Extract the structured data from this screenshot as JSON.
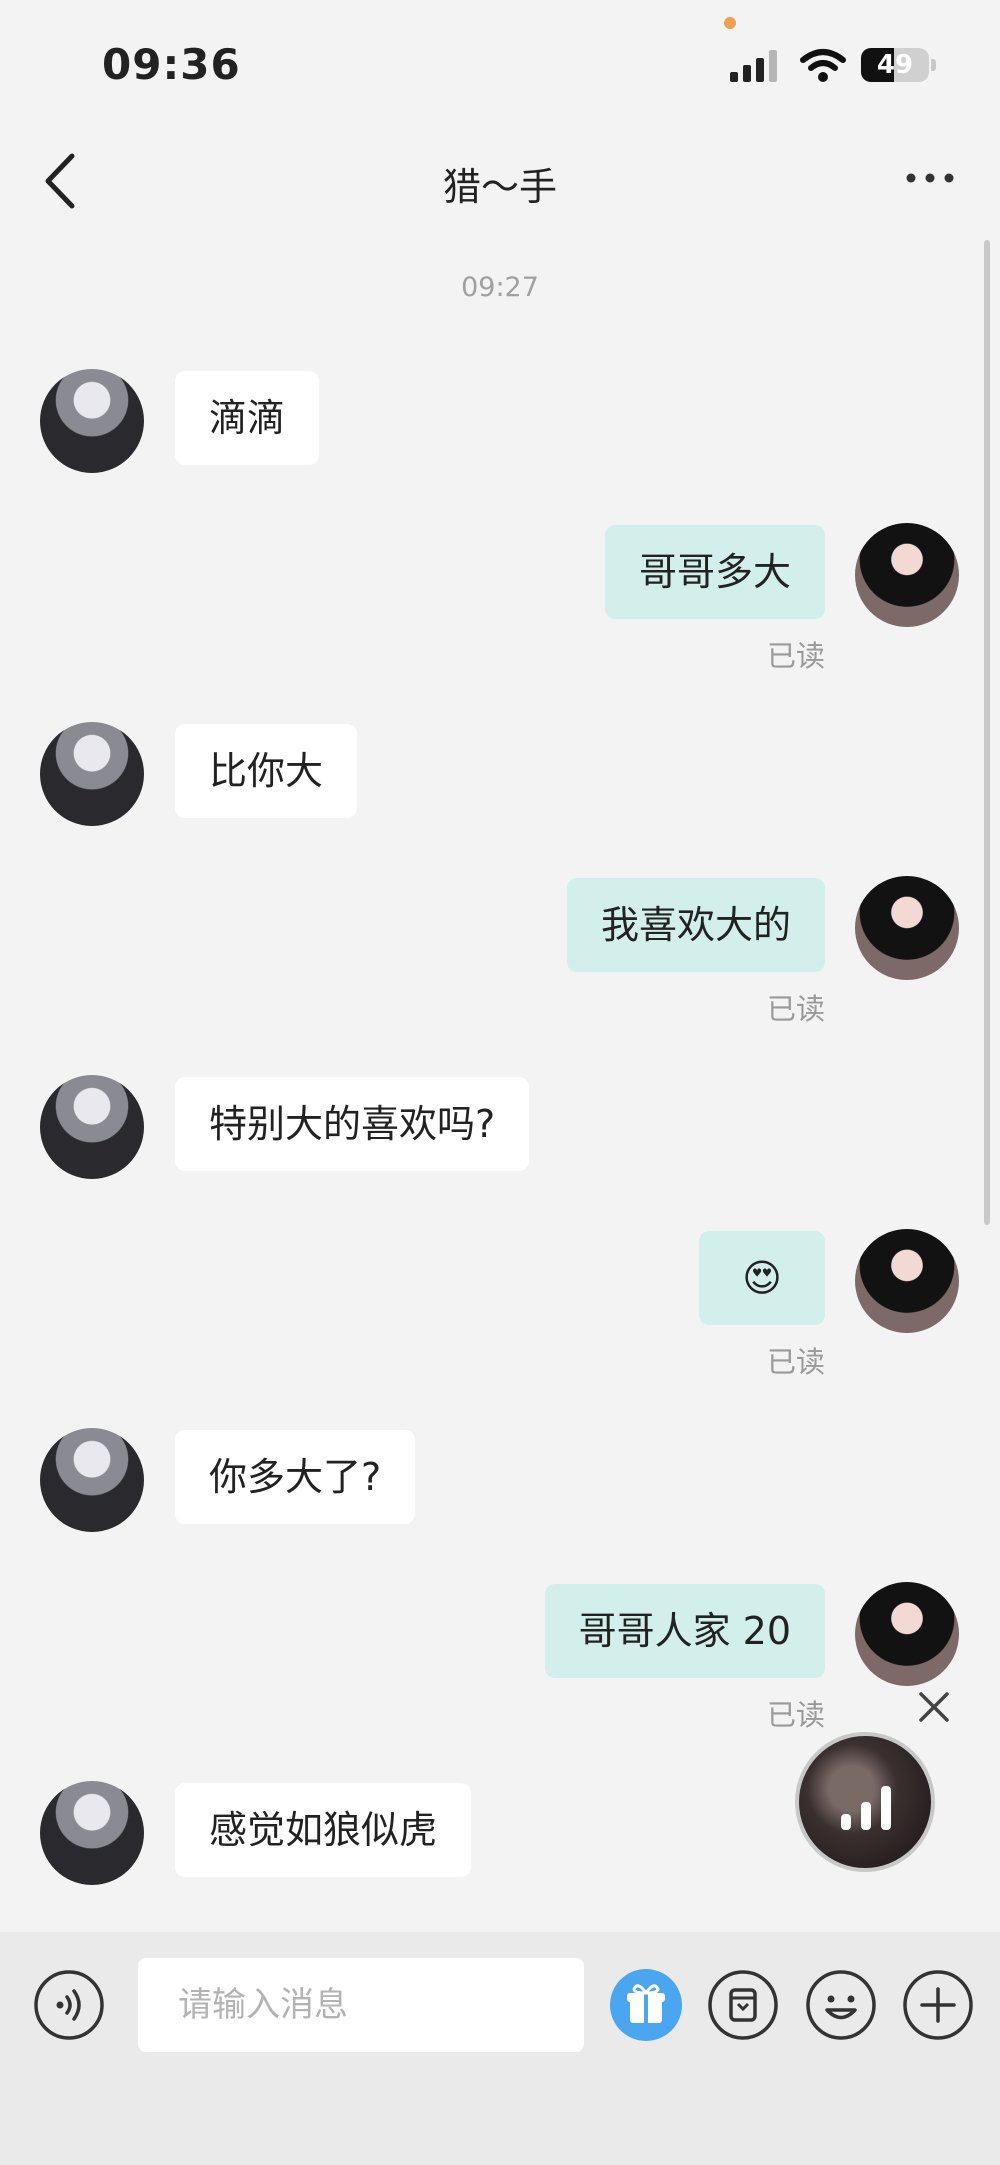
{
  "status_bar": {
    "time": "09:36",
    "battery": "49",
    "battery_level": 0.49
  },
  "header": {
    "title": "猎～手"
  },
  "chat": {
    "timestamp": "09:27",
    "read_label": "已读",
    "messages": [
      {
        "side": "left",
        "text": "滴滴"
      },
      {
        "side": "right",
        "text": "哥哥多大",
        "read": true
      },
      {
        "side": "left",
        "text": "比你大"
      },
      {
        "side": "right",
        "text": "我喜欢大的",
        "read": true
      },
      {
        "side": "left",
        "text": "特别大的喜欢吗?"
      },
      {
        "side": "right",
        "text": "😍",
        "read": true
      },
      {
        "side": "left",
        "text": "你多大了?"
      },
      {
        "side": "right",
        "text": "哥哥人家 20",
        "read": true
      },
      {
        "side": "left",
        "text": "感觉如狼似虎"
      }
    ]
  },
  "input_bar": {
    "placeholder": "请输入消息"
  },
  "icons": {
    "back": "chevron-left-icon",
    "more": "more-icon",
    "voice": "voice-icon",
    "gift": "gift-icon",
    "album": "album-icon",
    "emoji": "emoji-icon",
    "plus": "plus-icon",
    "close": "close-icon"
  },
  "colors": {
    "background": "#f3f3f3",
    "bubble_mine": "#d3efeb",
    "bubble_theirs": "#ffffff",
    "gift_accent": "#4aa6ef"
  }
}
